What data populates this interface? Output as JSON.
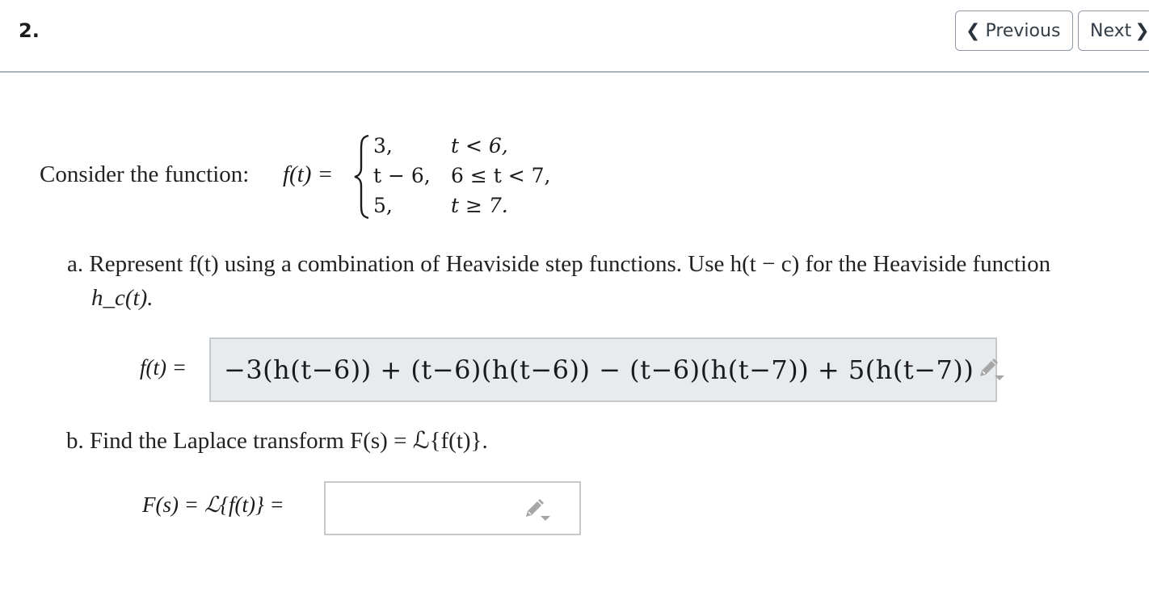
{
  "question": {
    "number": "2."
  },
  "navigation": {
    "previous_label": "Previous",
    "next_label": "Next",
    "previous_icon": "chevron-left-icon",
    "next_icon": "chevron-right-icon"
  },
  "intro": {
    "text": "Consider the function:",
    "function_lhs": "f(t) =",
    "cases": [
      {
        "value": "3,",
        "condition": "t < 6,"
      },
      {
        "value": "t − 6,",
        "condition": "6 ≤ t < 7,"
      },
      {
        "value": "5,",
        "condition": "t ≥ 7."
      }
    ]
  },
  "part_a": {
    "prompt_line1": "a. Represent f(t) using a combination of Heaviside step functions. Use h(t − c) for the Heaviside function",
    "prompt_line2": "h_c(t).",
    "answer_label": "f(t) =",
    "answer_value": "−3(h(t−6)) + (t−6)(h(t−6)) − (t−6)(h(t−7)) + 5(h(t−7))",
    "edit_icon": "pencil-dropdown-icon"
  },
  "part_b": {
    "prompt": "b. Find the Laplace transform F(s) = ℒ{f(t)}.",
    "answer_label": "F(s) = ℒ{f(t)} =",
    "answer_value": "",
    "edit_icon": "pencil-dropdown-icon"
  },
  "colors": {
    "button_border": "#8e99a4",
    "divider": "#adb4bb",
    "filled_answer_bg": "#e8ebee",
    "answer_border": "#c6c9cc",
    "icon_gray": "#a6a6a6"
  }
}
